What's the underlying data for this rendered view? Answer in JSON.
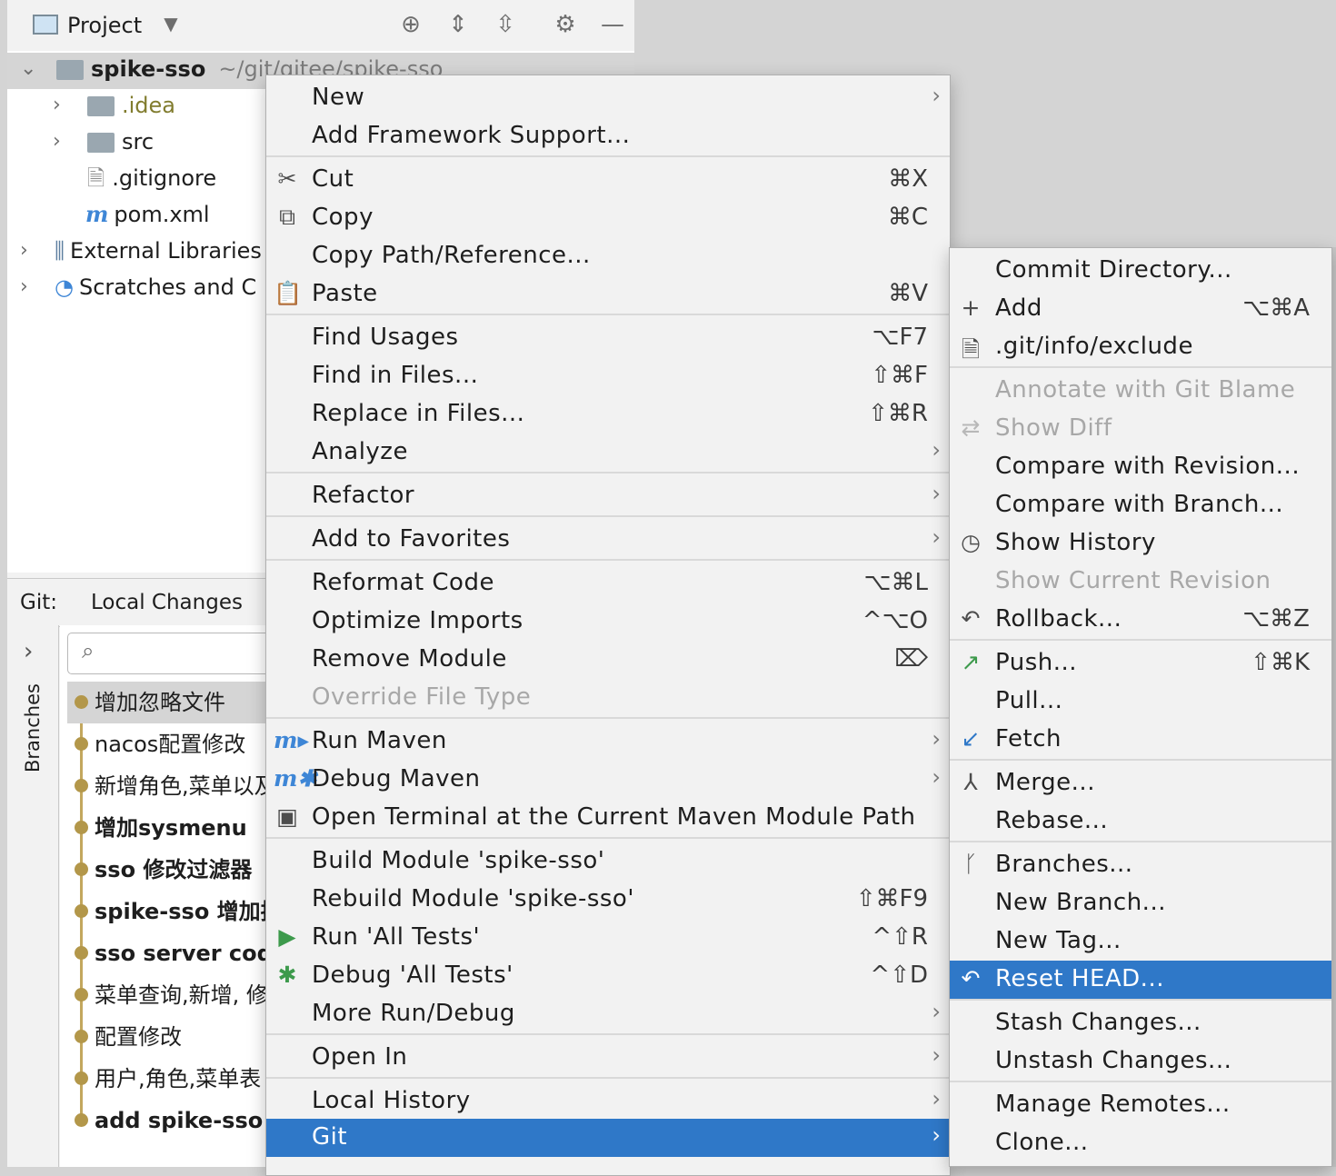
{
  "project_panel": {
    "title": "Project",
    "header_icons": [
      "locate-icon",
      "expand-all-icon",
      "collapse-all-icon",
      "gear-icon",
      "minimize-icon"
    ],
    "tree": {
      "root_name": "spike-sso",
      "root_path": "~/git/gitee/spike-sso",
      "items": [
        ".idea",
        "src",
        ".gitignore",
        "pom.xml",
        "External Libraries",
        "Scratches and C"
      ]
    }
  },
  "git_panel": {
    "label": "Git:",
    "tab": "Local Changes",
    "sidebar_label": "Branches",
    "commits": [
      "增加忽略文件",
      "nacos配置修改",
      "新增角色,菜单以及",
      "增加sysmenu",
      "sso 修改过滤器",
      "spike-sso 增加拦",
      "sso server code",
      "菜单查询,新增, 修",
      "配置修改",
      "用户,角色,菜单表",
      "add spike-sso"
    ]
  },
  "context_menu": {
    "items": [
      {
        "label": "New",
        "shortcut": "",
        "submenu": true
      },
      {
        "label": "Add Framework Support...",
        "shortcut": ""
      },
      {
        "label": "Cut",
        "shortcut": "⌘X",
        "icon": "scissors-icon"
      },
      {
        "label": "Copy",
        "shortcut": "⌘C",
        "icon": "copy-icon"
      },
      {
        "label": "Copy Path/Reference...",
        "shortcut": ""
      },
      {
        "label": "Paste",
        "shortcut": "⌘V",
        "icon": "clipboard-icon"
      },
      {
        "label": "Find Usages",
        "shortcut": "⌥F7"
      },
      {
        "label": "Find in Files...",
        "shortcut": "⇧⌘F"
      },
      {
        "label": "Replace in Files...",
        "shortcut": "⇧⌘R"
      },
      {
        "label": "Analyze",
        "submenu": true
      },
      {
        "label": "Refactor",
        "submenu": true
      },
      {
        "label": "Add to Favorites",
        "submenu": true
      },
      {
        "label": "Reformat Code",
        "shortcut": "⌥⌘L"
      },
      {
        "label": "Optimize Imports",
        "shortcut": "^⌥O"
      },
      {
        "label": "Remove Module",
        "shortcut": "⌦"
      },
      {
        "label": "Override File Type",
        "disabled": true
      },
      {
        "label": "Run Maven",
        "submenu": true,
        "icon": "maven-run-icon"
      },
      {
        "label": "Debug Maven",
        "submenu": true,
        "icon": "maven-debug-icon"
      },
      {
        "label": "Open Terminal at the Current Maven Module Path",
        "icon": "maven-terminal-icon"
      },
      {
        "label": "Build Module 'spike-sso'"
      },
      {
        "label": "Rebuild Module 'spike-sso'",
        "shortcut": "⇧⌘F9"
      },
      {
        "label": "Run 'All Tests'",
        "shortcut": "^⇧R",
        "icon": "run-icon"
      },
      {
        "label": "Debug 'All Tests'",
        "shortcut": "^⇧D",
        "icon": "debug-icon"
      },
      {
        "label": "More Run/Debug",
        "submenu": true
      },
      {
        "label": "Open In",
        "submenu": true
      },
      {
        "label": "Local History",
        "submenu": true
      },
      {
        "label": "Git",
        "submenu": true,
        "selected": true
      }
    ]
  },
  "git_submenu": {
    "items": [
      {
        "label": "Commit Directory..."
      },
      {
        "label": "Add",
        "shortcut": "⌥⌘A",
        "icon": "plus-icon"
      },
      {
        "label": ".git/info/exclude",
        "icon": "ignored-file-icon"
      },
      {
        "label": "Annotate with Git Blame",
        "disabled": true
      },
      {
        "label": "Show Diff",
        "disabled": true,
        "icon": "diff-icon"
      },
      {
        "label": "Compare with Revision..."
      },
      {
        "label": "Compare with Branch..."
      },
      {
        "label": "Show History",
        "icon": "clock-icon"
      },
      {
        "label": "Show Current Revision",
        "disabled": true
      },
      {
        "label": "Rollback...",
        "shortcut": "⌥⌘Z",
        "icon": "rollback-icon"
      },
      {
        "label": "Push...",
        "shortcut": "⇧⌘K",
        "icon": "push-icon"
      },
      {
        "label": "Pull..."
      },
      {
        "label": "Fetch",
        "icon": "fetch-icon"
      },
      {
        "label": "Merge...",
        "icon": "merge-icon"
      },
      {
        "label": "Rebase..."
      },
      {
        "label": "Branches...",
        "icon": "branch-icon"
      },
      {
        "label": "New Branch..."
      },
      {
        "label": "New Tag..."
      },
      {
        "label": "Reset HEAD...",
        "selected": true,
        "icon": "reset-icon"
      },
      {
        "label": "Stash Changes..."
      },
      {
        "label": "Unstash Changes..."
      },
      {
        "label": "Manage Remotes..."
      },
      {
        "label": "Clone..."
      }
    ]
  },
  "colors": {
    "selection": "#2f78c8",
    "menu_background": "#f2f2f2",
    "commit_graph": "#b3974a",
    "disabled_text": "#a8a8a8"
  }
}
